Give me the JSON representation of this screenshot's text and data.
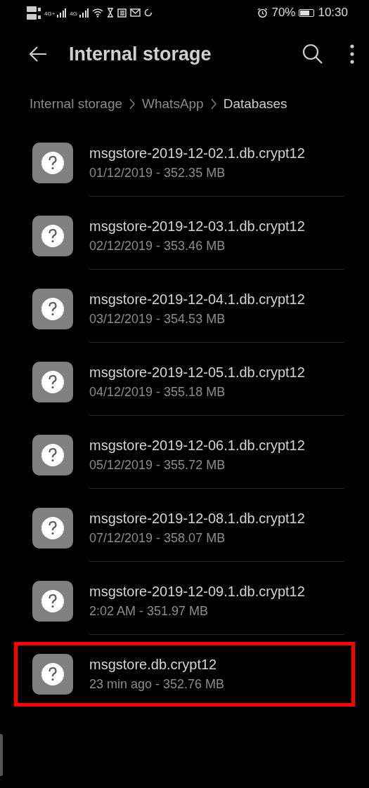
{
  "status_bar": {
    "network_1": "4G+",
    "network_2": "4G",
    "battery": "70%",
    "time": "10:30"
  },
  "toolbar": {
    "title": "Internal storage"
  },
  "breadcrumb": [
    {
      "label": "Internal storage",
      "selected": false
    },
    {
      "label": "WhatsApp",
      "selected": false
    },
    {
      "label": "Databases",
      "selected": true
    }
  ],
  "files": [
    {
      "name": "msgstore-2019-12-02.1.db.crypt12",
      "details": "01/12/2019 - 352.35 MB",
      "highlighted": false
    },
    {
      "name": "msgstore-2019-12-03.1.db.crypt12",
      "details": "02/12/2019 - 353.46 MB",
      "highlighted": false
    },
    {
      "name": "msgstore-2019-12-04.1.db.crypt12",
      "details": "03/12/2019 - 354.53 MB",
      "highlighted": false
    },
    {
      "name": "msgstore-2019-12-05.1.db.crypt12",
      "details": "04/12/2019 - 355.18 MB",
      "highlighted": false
    },
    {
      "name": "msgstore-2019-12-06.1.db.crypt12",
      "details": "05/12/2019 - 355.72 MB",
      "highlighted": false
    },
    {
      "name": "msgstore-2019-12-08.1.db.crypt12",
      "details": "07/12/2019 - 358.07 MB",
      "highlighted": false
    },
    {
      "name": "msgstore-2019-12-09.1.db.crypt12",
      "details": "2:02 AM - 351.97 MB",
      "highlighted": false
    },
    {
      "name": "msgstore.db.crypt12",
      "details": "23 min ago - 352.76 MB",
      "highlighted": true
    }
  ]
}
